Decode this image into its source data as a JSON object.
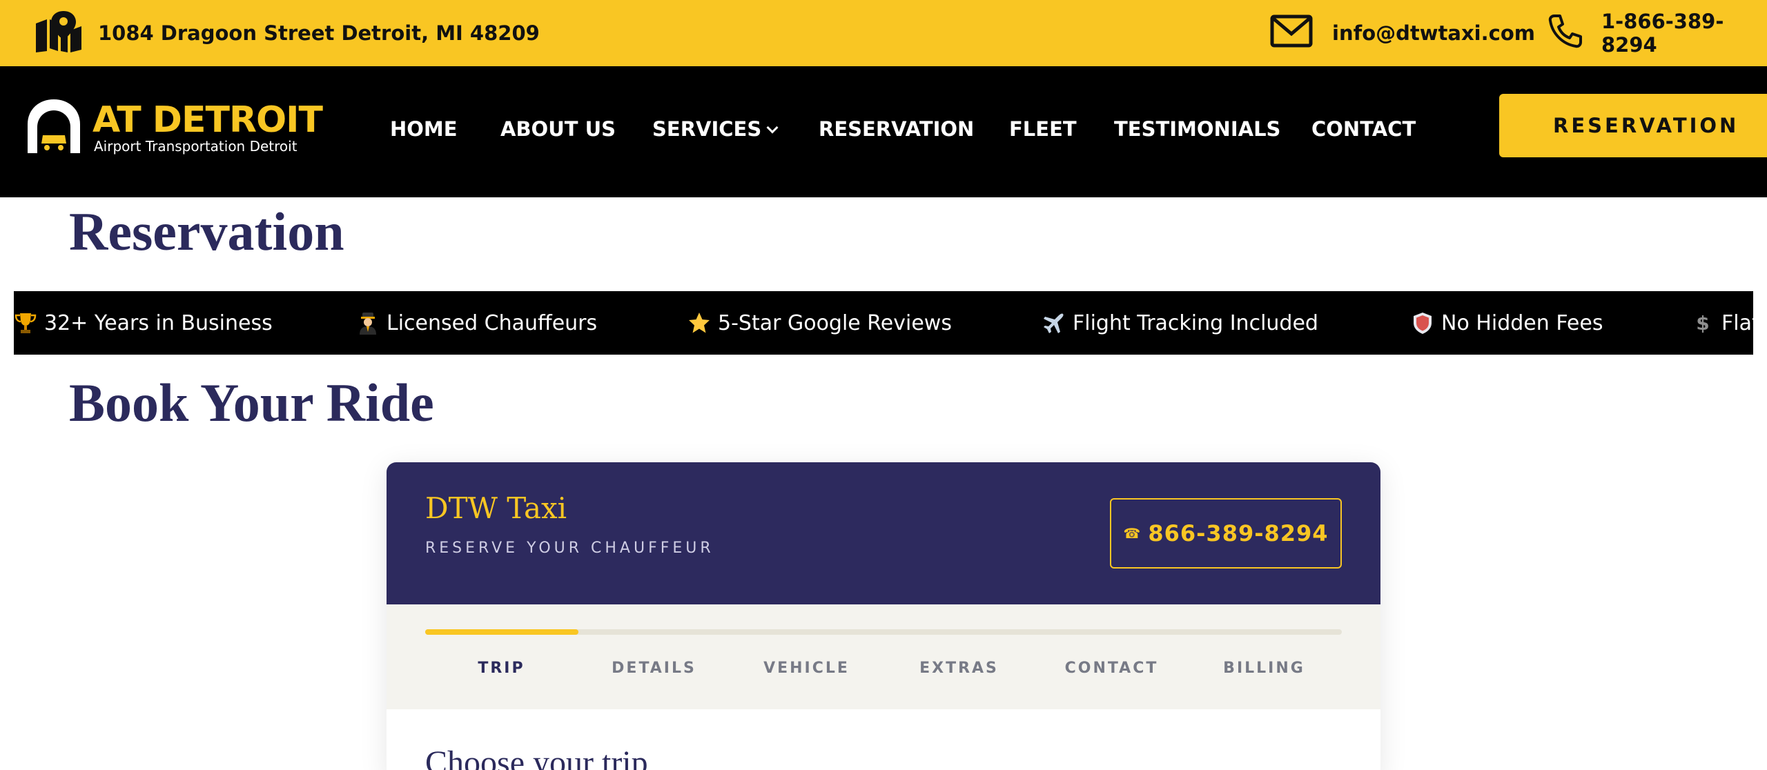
{
  "topbar": {
    "address": "1084 Dragoon Street Detroit, MI 48209",
    "email": "info@dtwtaxi.com",
    "phone": "1-866-389-8294",
    "background": "#F9C623"
  },
  "brand": {
    "name": "AT DETROIT",
    "tagline": "Airport Transportation Detroit",
    "accent": "#F9C623"
  },
  "nav": {
    "items": [
      {
        "label": "HOME"
      },
      {
        "label": "ABOUT US"
      },
      {
        "label": "SERVICES",
        "has_dropdown": true
      },
      {
        "label": "RESERVATION"
      },
      {
        "label": "FLEET"
      },
      {
        "label": "TESTIMONIALS"
      },
      {
        "label": "CONTACT"
      }
    ],
    "cta_label": "RESERVATION"
  },
  "page": {
    "title": "Reservation",
    "section_title": "Book Your Ride"
  },
  "marquee": {
    "items": [
      {
        "icon": "trophy-icon",
        "text": "32+ Years in Business"
      },
      {
        "icon": "chauffeur-icon",
        "text": "Licensed Chauffeurs"
      },
      {
        "icon": "star-icon",
        "text": "5-Star Google Reviews"
      },
      {
        "icon": "airplane-icon",
        "text": "Flight Tracking Included"
      },
      {
        "icon": "shield-icon",
        "text": "No Hidden Fees"
      },
      {
        "icon": "dollar-icon",
        "text": "Flat"
      }
    ]
  },
  "booking": {
    "title": "DTW Taxi",
    "subtitle": "RESERVE YOUR CHAUFFEUR",
    "phone_label": "866-389-8294",
    "progress": 0.167,
    "steps": [
      "TRIP",
      "DETAILS",
      "VEHICLE",
      "EXTRAS",
      "CONTACT",
      "BILLING"
    ],
    "active_step": 0,
    "body_heading": "Choose your trip",
    "header_color": "#2D2A5E"
  }
}
